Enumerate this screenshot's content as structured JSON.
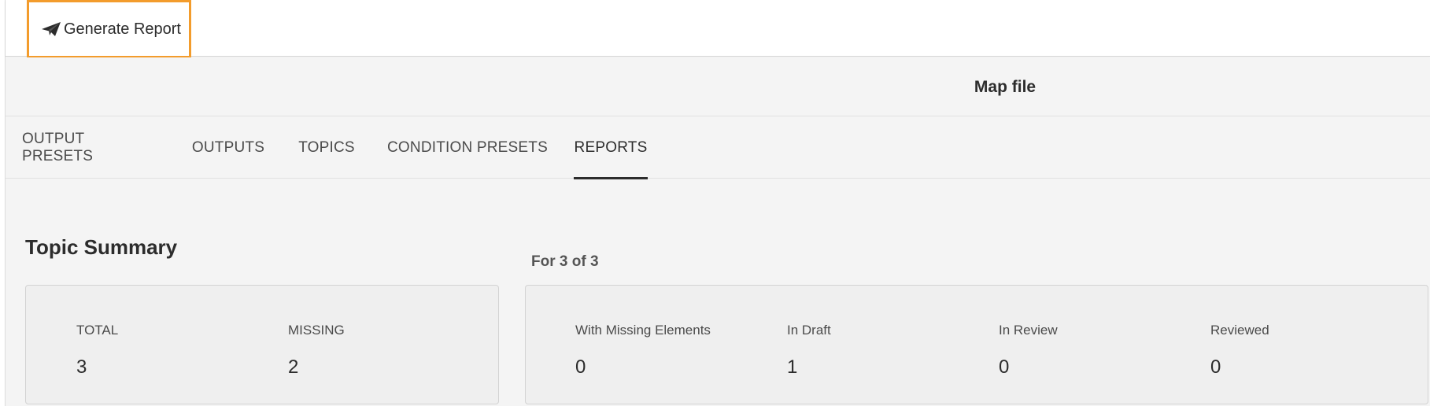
{
  "toolbar": {
    "generate_label": "Generate Report",
    "generate_icon": "paper-plane-icon",
    "highlight_color": "#f39c2c"
  },
  "header": {
    "title": "Map file"
  },
  "tabs": [
    {
      "label": "OUTPUT PRESETS",
      "active": false
    },
    {
      "label": "OUTPUTS",
      "active": false
    },
    {
      "label": "TOPICS",
      "active": false
    },
    {
      "label": "CONDITION PRESETS",
      "active": false
    },
    {
      "label": "REPORTS",
      "active": true
    }
  ],
  "topic_summary": {
    "title": "Topic Summary",
    "stats": [
      {
        "label": "TOTAL",
        "value": "3"
      },
      {
        "label": "MISSING",
        "value": "2"
      }
    ]
  },
  "status_summary": {
    "scope_label": "For 3 of 3",
    "stats": [
      {
        "label": "With Missing Elements",
        "value": "0"
      },
      {
        "label": "In Draft",
        "value": "1"
      },
      {
        "label": "In Review",
        "value": "0"
      },
      {
        "label": "Reviewed",
        "value": "0"
      }
    ]
  }
}
